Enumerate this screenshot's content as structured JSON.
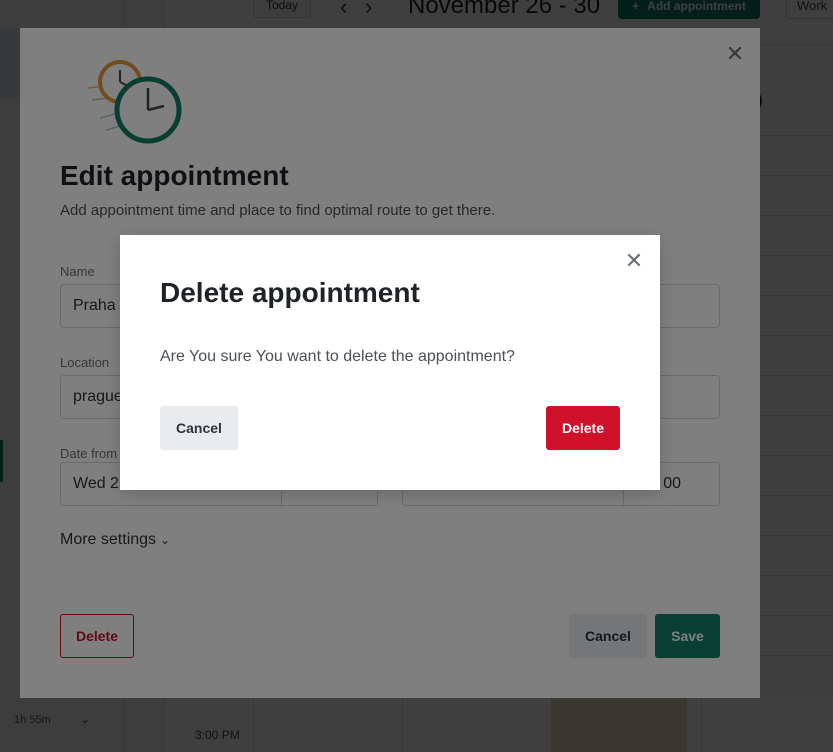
{
  "calendar": {
    "today_label": "Today",
    "prev_icon": "chevron-left-icon",
    "next_icon": "chevron-right-icon",
    "week_title": "November 26 - 30",
    "add_button_label": "Add appointment",
    "add_icon": "plus-icon",
    "view_select_label": "Work",
    "time_labels": [
      "3:00 PM"
    ],
    "sidebar_duration": "1h 55m"
  },
  "edit_modal": {
    "title": "Edit appointment",
    "subtitle": "Add appointment time and place to find optimal route to get there.",
    "name_label": "Name",
    "name_value": "Praha",
    "location_label": "Location",
    "location_value": "prague",
    "date_from_label": "Date from",
    "date_from_value": "Wed 2",
    "date_to_time_value": "00",
    "more_settings_label": "More settings",
    "delete_label": "Delete",
    "cancel_label": "Cancel",
    "save_label": "Save"
  },
  "confirm_dialog": {
    "title": "Delete appointment",
    "message": "Are You sure You want to delete the appointment?",
    "cancel_label": "Cancel",
    "delete_label": "Delete"
  },
  "colors": {
    "primary": "#127c66",
    "danger": "#d0112b",
    "neutral_button": "#e9ecef"
  }
}
